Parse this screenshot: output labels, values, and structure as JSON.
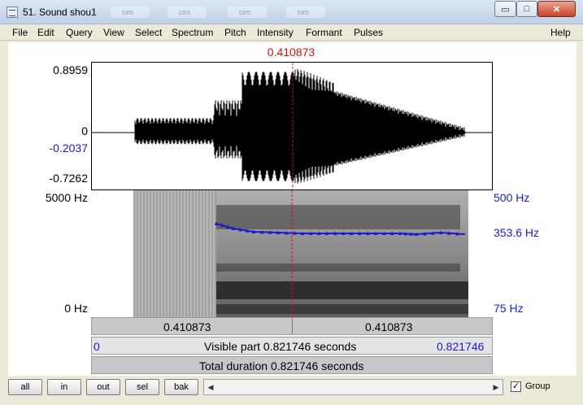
{
  "window": {
    "title": "51. Sound shou1",
    "ghost_tabs": [
      "ces",
      "ces",
      "ces",
      "ces"
    ],
    "buttons": {
      "minimize": "▭",
      "maximize": "□",
      "close": "✕"
    }
  },
  "menu": {
    "items": [
      "File",
      "Edit",
      "Query",
      "View",
      "Select",
      "Spectrum",
      "Pitch",
      "Intensity",
      "Formant",
      "Pulses"
    ],
    "help": "Help"
  },
  "cursor": {
    "time": "0.410873"
  },
  "waveform": {
    "ymax": "0.8959",
    "zero": "0",
    "cursor_value": "-0.2037",
    "ymin": "-0.7262"
  },
  "spectrogram": {
    "freq_max": "5000 Hz",
    "freq_min": "0 Hz",
    "pitch_max": "500 Hz",
    "pitch_current": "353.6 Hz",
    "pitch_min": "75 Hz"
  },
  "bars": {
    "left_segment": "0.410873",
    "right_segment": "0.410873",
    "visible_start": "0",
    "visible_label": "Visible part 0.821746 seconds",
    "visible_end": "0.821746",
    "total_label": "Total duration 0.821746 seconds"
  },
  "toolbar": {
    "all": "all",
    "in": "in",
    "out": "out",
    "sel": "sel",
    "bak": "bak",
    "group_label": "Group",
    "group_checked": "✓"
  },
  "colors": {
    "cursor": "#d01010",
    "pitch": "#1a1ad0",
    "menubar": "#ece9d8"
  }
}
